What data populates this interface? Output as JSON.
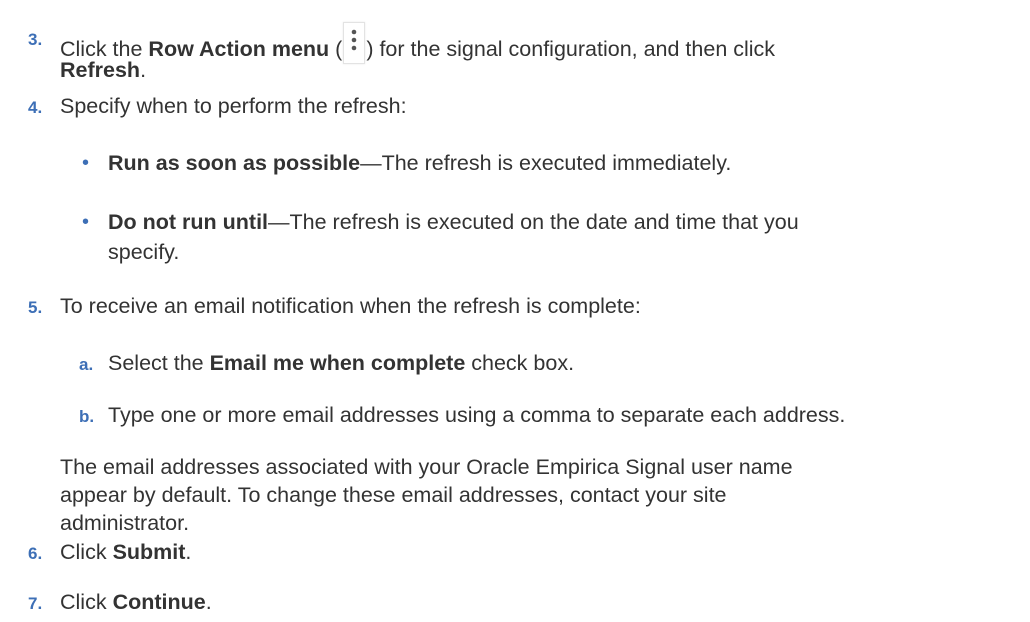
{
  "steps": [
    {
      "num": "3.",
      "pre": "Click the ",
      "b1": "Row Action menu",
      "mid1": " (",
      "icon": "kebab-icon",
      "mid2": ") for the signal configuration, and then click",
      "b2": "Refresh",
      "end": "."
    },
    {
      "num": "4.",
      "text": "Specify when to perform the refresh:",
      "bullets": [
        {
          "bold": "Run as soon as possible",
          "rest": "—The refresh is executed immediately."
        },
        {
          "bold": "Do not run until",
          "rest": "—The refresh is executed on the date and time that you",
          "rest2": "specify."
        }
      ]
    },
    {
      "num": "5.",
      "text": "To receive an email notification when the refresh is complete:",
      "substeps": [
        {
          "label": "a.",
          "pre": "Select the ",
          "bold": "Email me when complete",
          "post": " check box."
        },
        {
          "label": "b.",
          "text": "Type one or more email addresses using a comma to separate each address."
        }
      ],
      "note": [
        "The email addresses associated with your Oracle Empirica Signal user name",
        "appear by default. To change these email addresses, contact your site",
        "administrator."
      ]
    },
    {
      "num": "6.",
      "pre": "Click ",
      "bold": "Submit",
      "end": "."
    },
    {
      "num": "7.",
      "pre": "Click ",
      "bold": "Continue",
      "end": "."
    }
  ]
}
